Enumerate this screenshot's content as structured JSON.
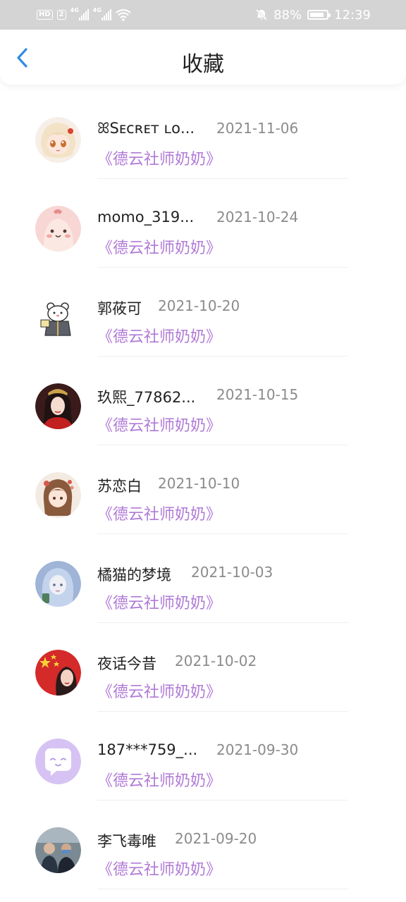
{
  "status_bar": {
    "hd": "HD",
    "sim": "2",
    "network1": "4G",
    "network2": "4G",
    "battery": "88%",
    "battery_level": 0.88,
    "time": "12:39",
    "icons": [
      "signal-icon",
      "wifi-icon",
      "mute-icon",
      "battery-icon"
    ]
  },
  "header": {
    "title": "收藏",
    "back_icon": "chevron-left-icon"
  },
  "colors": {
    "accent": "#2f8de4",
    "favorite_text": "#b07ad6",
    "date_text": "#8b8b8b"
  },
  "items": [
    {
      "name": "ꕤSᴇᴄʀᴇᴛ ʟᴏ...",
      "date": "2021-11-06",
      "favorite": "《德云社师奶奶》",
      "avatar": "anime-girl-white-hair-avatar"
    },
    {
      "name": "momo_319...",
      "date": "2021-10-24",
      "favorite": "《德云社师奶奶》",
      "avatar": "pink-cartoon-avatar"
    },
    {
      "name": "郭莜可",
      "date": "2021-10-20",
      "favorite": "《德云社师奶奶》",
      "avatar": "hamster-sticker-avatar"
    },
    {
      "name": "玖熙_77862...",
      "date": "2021-10-15",
      "favorite": "《德云社师奶奶》",
      "avatar": "red-costume-girl-avatar"
    },
    {
      "name": "苏恋白",
      "date": "2021-10-10",
      "favorite": "《德云社师奶奶》",
      "avatar": "anime-girl-flowers-avatar"
    },
    {
      "name": "橘猫的梦境",
      "date": "2021-10-03",
      "favorite": "《德云社师奶奶》",
      "avatar": "blue-hair-girl-avatar"
    },
    {
      "name": "夜话今昔",
      "date": "2021-10-02",
      "favorite": "《德云社师奶奶》",
      "avatar": "flag-girl-avatar"
    },
    {
      "name": "187***759_...",
      "date": "2021-09-30",
      "favorite": "《德云社师奶奶》",
      "avatar": "default-chat-avatar"
    },
    {
      "name": "李飞毒唯",
      "date": "2021-09-20",
      "favorite": "《德云社师奶奶》",
      "avatar": "crowd-photo-avatar"
    }
  ]
}
